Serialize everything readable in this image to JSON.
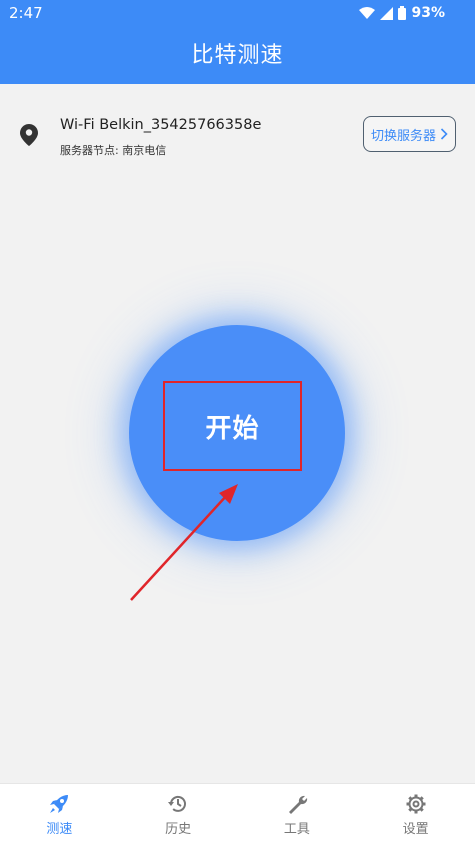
{
  "status_bar": {
    "time": "2:47",
    "battery": "93%"
  },
  "app_bar": {
    "title": "比特测速"
  },
  "network": {
    "wifi_name": "Wi-Fi Belkin_35425766358e",
    "server_node": "服务器节点: 南京电信",
    "switch_label": "切换服务器"
  },
  "start_button": {
    "label": "开始"
  },
  "nav": {
    "items": [
      {
        "label": "测速",
        "icon": "rocket-icon",
        "active": true
      },
      {
        "label": "历史",
        "icon": "history-icon",
        "active": false
      },
      {
        "label": "工具",
        "icon": "wrench-icon",
        "active": false
      },
      {
        "label": "设置",
        "icon": "gear-icon",
        "active": false
      }
    ]
  },
  "colors": {
    "primary": "#3d8bf7",
    "annotation": "#e0252a",
    "background": "#f2f2f2"
  }
}
